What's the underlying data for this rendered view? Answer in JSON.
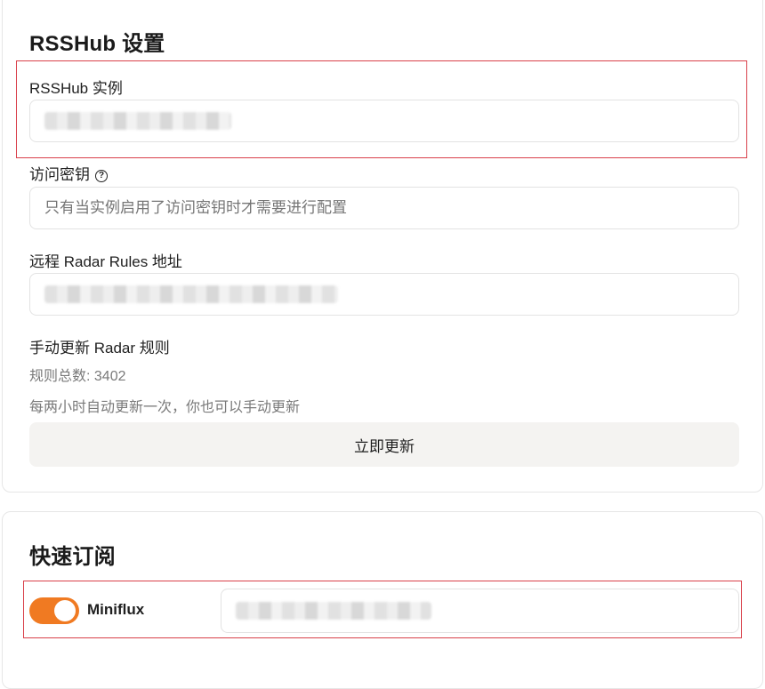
{
  "rsshub": {
    "title": "RSSHub 设置",
    "instance_label": "RSSHub 实例",
    "instance_value": "",
    "access_key_label": "访问密钥",
    "access_key_placeholder": "只有当实例启用了访问密钥时才需要进行配置",
    "radar_rules_label": "远程 Radar Rules 地址",
    "radar_rules_value": "",
    "manual_update_label": "手动更新 Radar 规则",
    "rules_total": "规则总数: 3402",
    "auto_update_note": "每两小时自动更新一次，你也可以手动更新",
    "update_button": "立即更新"
  },
  "quick_subscribe": {
    "title": "快速订阅",
    "miniflux_label": "Miniflux",
    "miniflux_enabled": true,
    "miniflux_value": ""
  },
  "colors": {
    "accent": "#f07a22",
    "highlight_border": "#d9404a"
  },
  "icons": {
    "help": "question-circle-icon"
  }
}
